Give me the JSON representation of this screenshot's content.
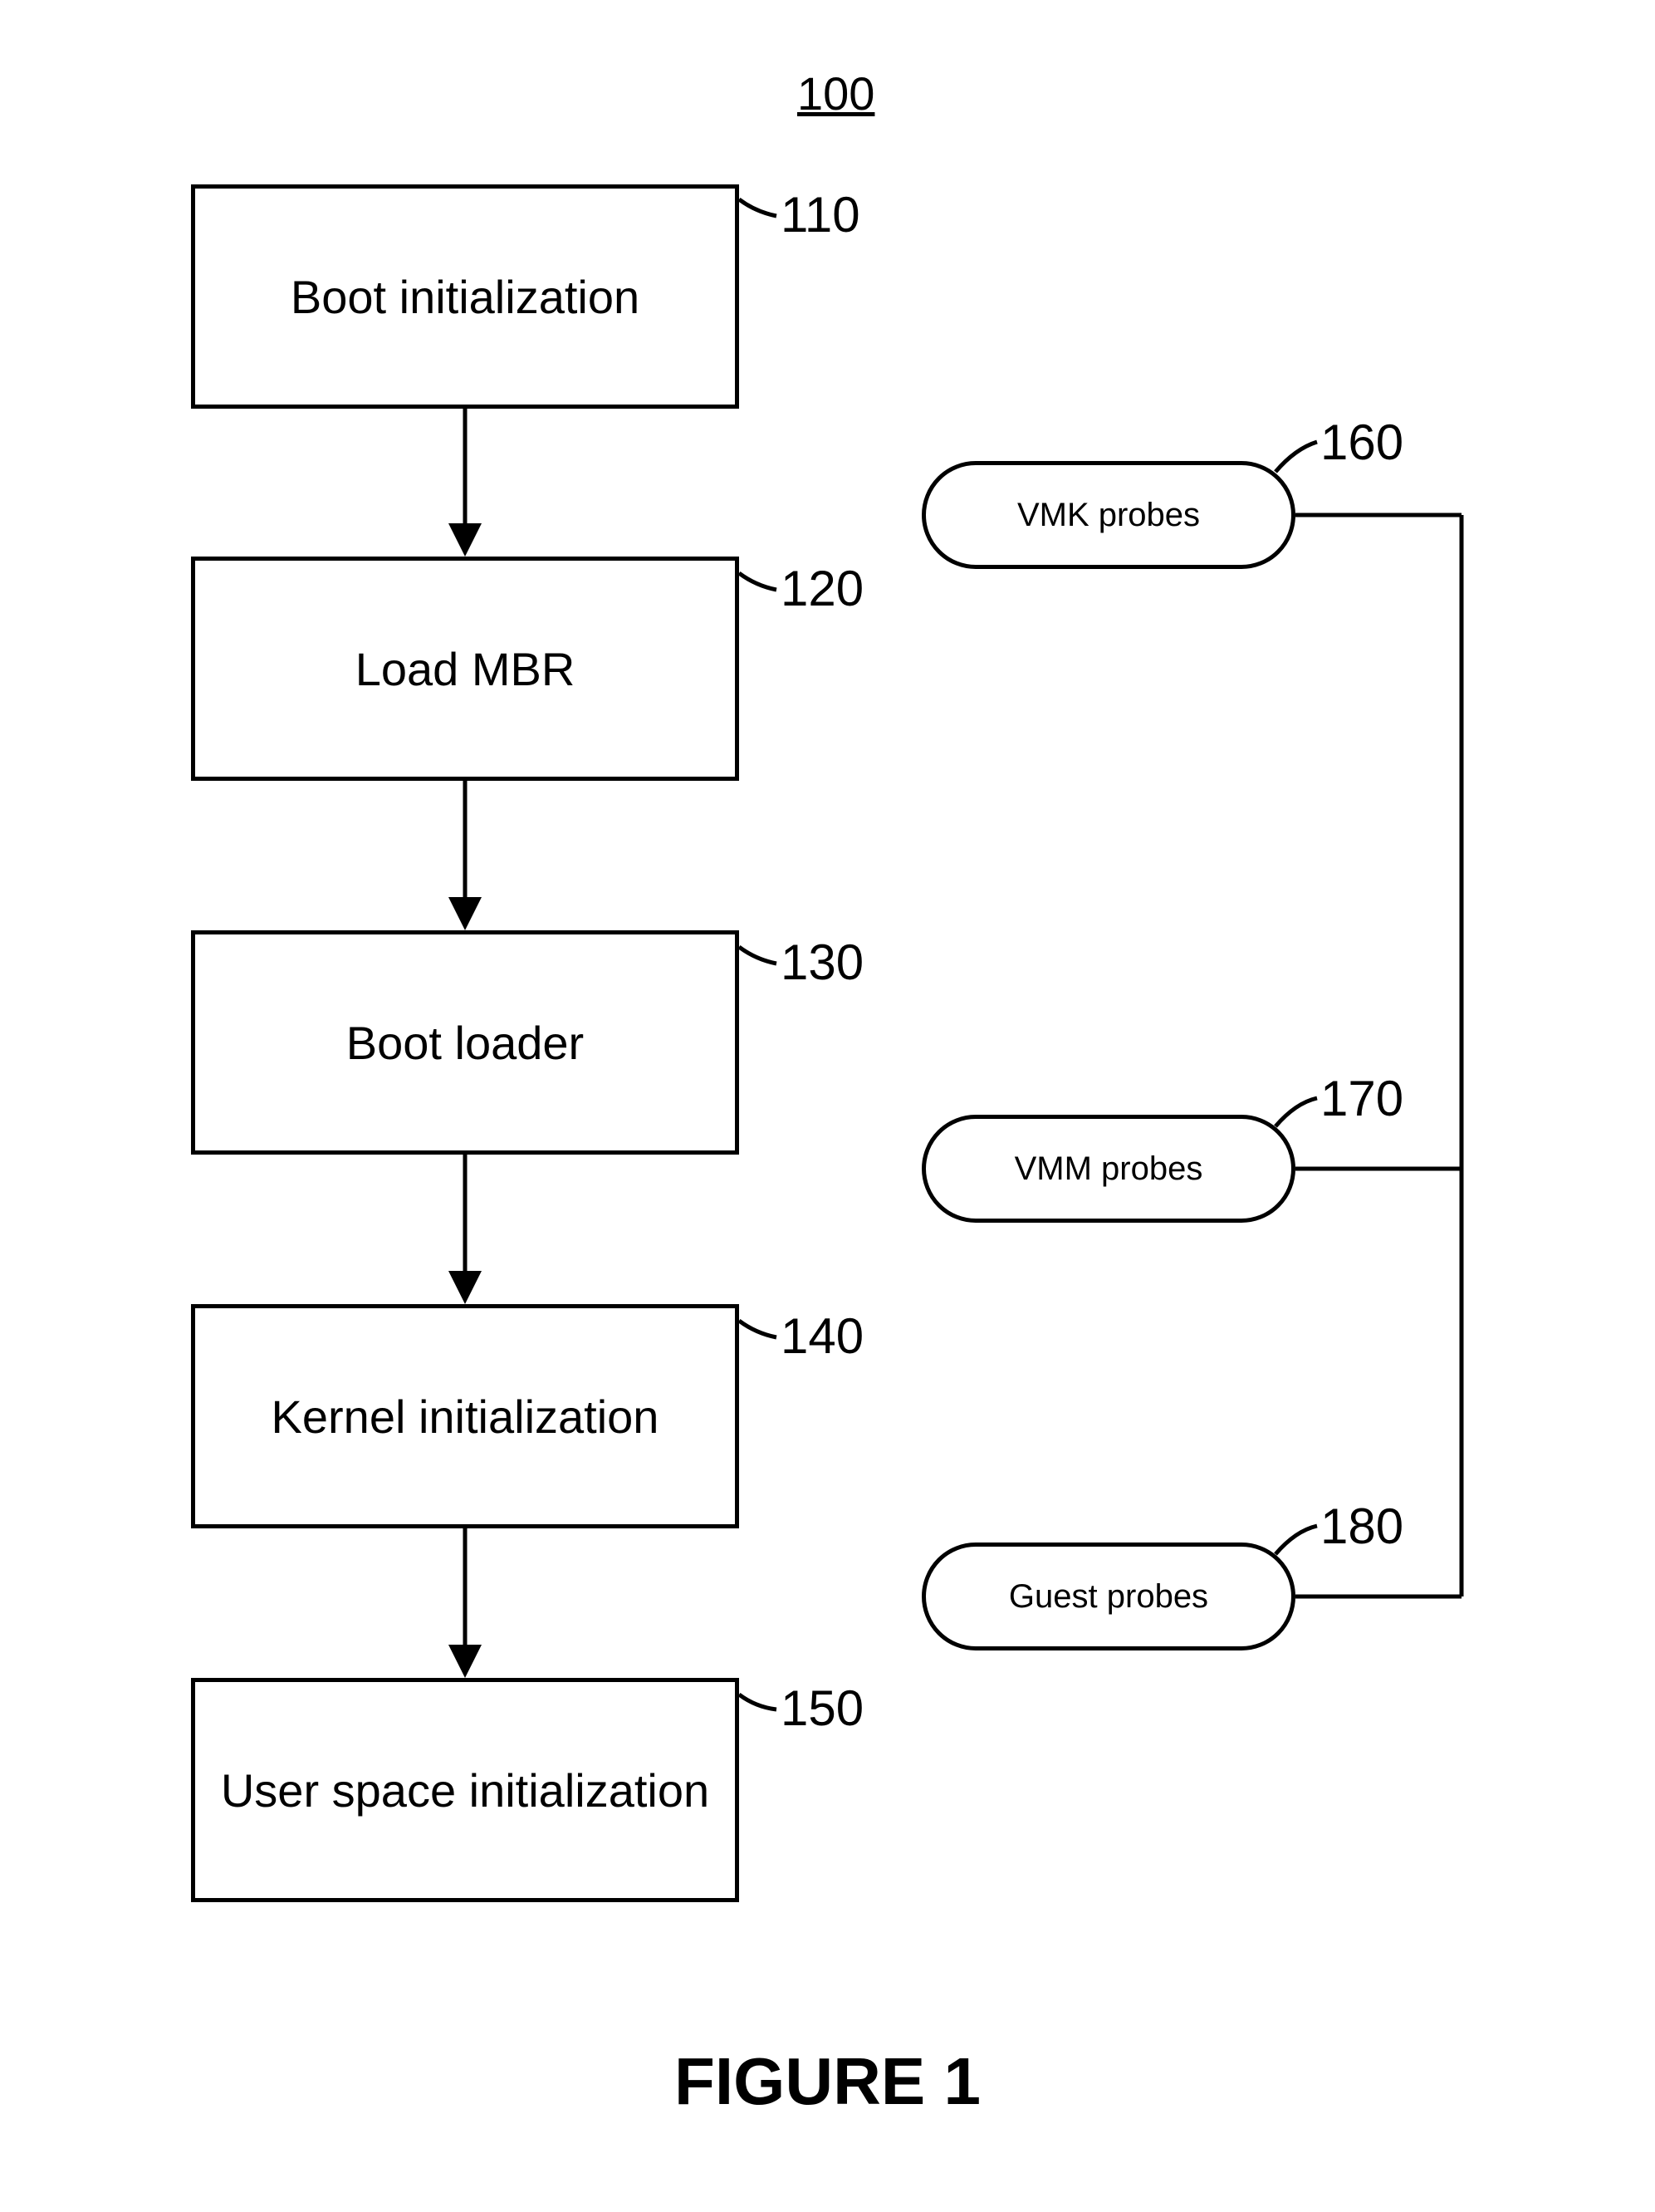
{
  "figure": {
    "title": "100",
    "caption": "FIGURE 1"
  },
  "flow": {
    "step110": {
      "label": "Boot initialization",
      "num": "110"
    },
    "step120": {
      "label": "Load MBR",
      "num": "120"
    },
    "step130": {
      "label": "Boot loader",
      "num": "130"
    },
    "step140": {
      "label": "Kernel initialization",
      "num": "140"
    },
    "step150": {
      "label": "User space initialization",
      "num": "150"
    }
  },
  "probes": {
    "p160": {
      "label": "VMK probes",
      "num": "160"
    },
    "p170": {
      "label": "VMM probes",
      "num": "170"
    },
    "p180": {
      "label": "Guest probes",
      "num": "180"
    }
  }
}
